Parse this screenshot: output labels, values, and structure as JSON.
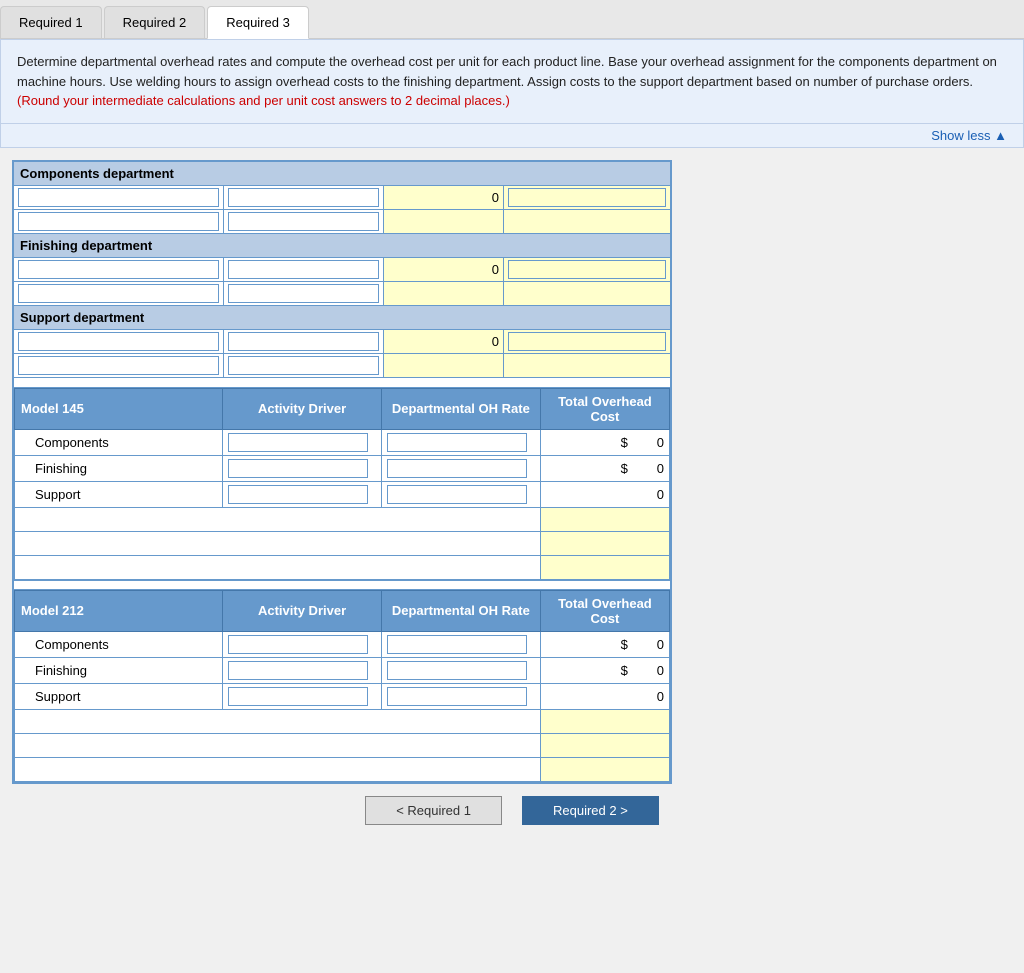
{
  "tabs": [
    {
      "id": "req1",
      "label": "Required 1",
      "active": false
    },
    {
      "id": "req2",
      "label": "Required 2",
      "active": false
    },
    {
      "id": "req3",
      "label": "Required 3",
      "active": true
    }
  ],
  "instructions": {
    "text": "Determine departmental overhead rates and compute the overhead cost per unit for each product line. Base your overhead assignment for the components department on machine hours. Use welding hours to assign overhead costs to the finishing department. Assign costs to the support department based on number of purchase orders.",
    "red_text": "(Round your intermediate calculations and per unit cost answers to 2 decimal places.)",
    "show_less": "Show less ▲"
  },
  "departments": [
    {
      "name": "Components department",
      "rows": [
        {
          "col1": "",
          "col2": "",
          "col3": "0",
          "col4": ""
        },
        {
          "col1": "",
          "col2": "",
          "col3": "",
          "col4": ""
        }
      ]
    },
    {
      "name": "Finishing department",
      "rows": [
        {
          "col1": "",
          "col2": "",
          "col3": "0",
          "col4": ""
        },
        {
          "col1": "",
          "col2": "",
          "col3": "",
          "col4": ""
        }
      ]
    },
    {
      "name": "Support department",
      "rows": [
        {
          "col1": "",
          "col2": "",
          "col3": "0",
          "col4": ""
        },
        {
          "col1": "",
          "col2": "",
          "col3": "",
          "col4": ""
        }
      ]
    }
  ],
  "model145": {
    "title": "Model 145",
    "headers": [
      "Activity Driver",
      "Departmental OH Rate",
      "Total Overhead Cost"
    ],
    "rows": [
      {
        "dept": "Components",
        "driver": "",
        "rate": "",
        "dollar": "$",
        "total": "0"
      },
      {
        "dept": "Finishing",
        "driver": "",
        "rate": "",
        "dollar": "$",
        "total": "0"
      },
      {
        "dept": "Support",
        "driver": "",
        "rate": "",
        "dollar": "",
        "total": "0"
      }
    ],
    "total_rows": [
      {
        "col1": "",
        "col2": "",
        "col3": ""
      },
      {
        "col1": "",
        "col2": "",
        "col3": ""
      },
      {
        "col1": "",
        "col2": "",
        "col3": ""
      }
    ]
  },
  "model212": {
    "title": "Model 212",
    "headers": [
      "Activity Driver",
      "Departmental OH Rate",
      "Total Overhead Cost"
    ],
    "rows": [
      {
        "dept": "Components",
        "driver": "",
        "rate": "",
        "dollar": "$",
        "total": "0"
      },
      {
        "dept": "Finishing",
        "driver": "",
        "rate": "",
        "dollar": "$",
        "total": "0"
      },
      {
        "dept": "Support",
        "driver": "",
        "rate": "",
        "dollar": "",
        "total": "0"
      }
    ],
    "total_rows": [
      {
        "col1": "",
        "col2": "",
        "col3": ""
      },
      {
        "col1": "",
        "col2": "",
        "col3": ""
      },
      {
        "col1": "",
        "col2": "",
        "col3": ""
      }
    ]
  },
  "buttons": {
    "prev_label": "< Required 1",
    "next_label": "Required 2 >"
  }
}
